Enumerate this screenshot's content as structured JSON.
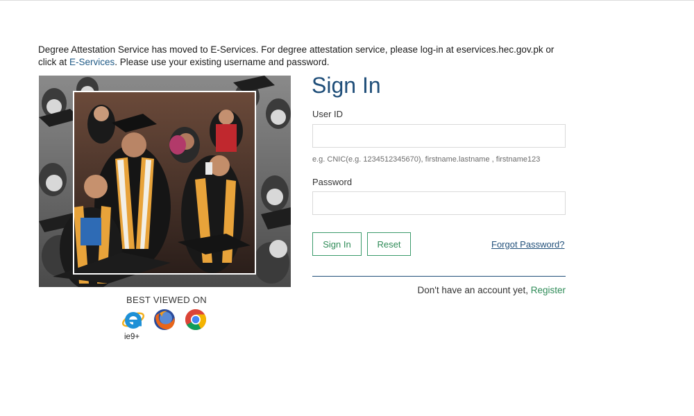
{
  "notice": {
    "text_before": "Degree Attestation Service has moved to E-Services. For degree attestation service, please log-in at eservices.hec.gov.pk or click at ",
    "link": "E-Services",
    "text_after": ". Please use your existing username and password."
  },
  "browsers": {
    "label": "BEST VIEWED ON",
    "ie_version": "ie9+",
    "icons": [
      "internet-explorer-icon",
      "firefox-icon",
      "chrome-icon"
    ]
  },
  "form": {
    "title": "Sign In",
    "user_id_label": "User ID",
    "user_id_value": "",
    "user_id_hint": "e.g. CNIC(e.g. 1234512345670), firstname.lastname , firstname123",
    "password_label": "Password",
    "password_value": "",
    "signin_button": "Sign In",
    "reset_button": "Reset",
    "forgot_link": "Forgot Password?",
    "account_prompt": "Don't have an account yet,",
    "register_link": "Register"
  },
  "colors": {
    "heading_blue": "#1f4e79",
    "accent_green": "#2e8b57",
    "link_blue": "#1f5a86"
  }
}
